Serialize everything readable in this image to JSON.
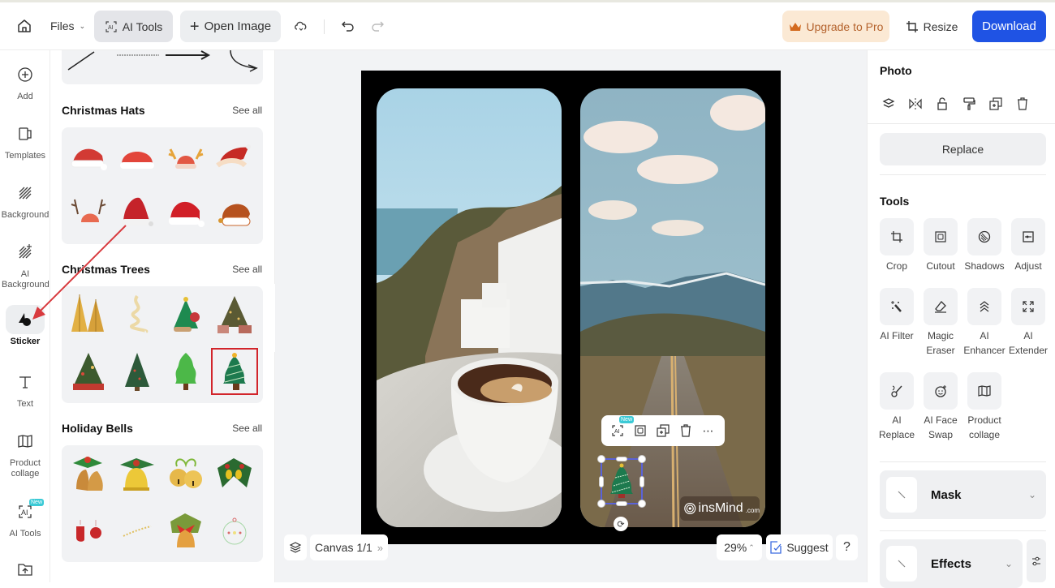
{
  "topbar": {
    "files_label": "Files",
    "ai_tools_label": "AI Tools",
    "open_image_label": "Open Image",
    "upgrade_label": "Upgrade to Pro",
    "resize_label": "Resize",
    "download_label": "Download",
    "colors": {
      "download_bg": "#1f53e4",
      "upgrade_bg": "#fbe9d4",
      "upgrade_text": "#b4622c"
    }
  },
  "leftnav": {
    "items": [
      {
        "label": "Add",
        "icon": "plus-circle-icon"
      },
      {
        "label": "Templates",
        "icon": "templates-icon"
      },
      {
        "label": "Background",
        "icon": "background-icon"
      },
      {
        "label": "AI Background",
        "icon": "ai-background-icon"
      },
      {
        "label": "Sticker",
        "icon": "sticker-icon",
        "active": true
      },
      {
        "label": "Text",
        "icon": "text-icon"
      },
      {
        "label": "Product collage",
        "icon": "collage-icon"
      },
      {
        "label": "AI Tools",
        "icon": "ai-tools-icon",
        "badge": "New"
      },
      {
        "label": "",
        "icon": "upload-icon"
      }
    ]
  },
  "sticker_panel": {
    "see_all": "See all",
    "sections": [
      {
        "title": "Christmas Hats",
        "stickers": [
          "santa-hat-1",
          "santa-hat-2",
          "reindeer-hat",
          "santa-hat-3",
          "reindeer-antlers",
          "santa-hat-4",
          "santa-hat-5",
          "brown-hat"
        ]
      },
      {
        "title": "Christmas Trees",
        "stickers": [
          "golden-trees",
          "spiral-tree",
          "cartoon-tree",
          "decorated-tree-gifts",
          "tree-with-gifts",
          "decorated-tree",
          "green-tree",
          "green-tree-lights"
        ],
        "selected_index": 7
      },
      {
        "title": "Holiday Bells",
        "stickers": [
          "golden-bells-holly",
          "yellow-bell",
          "jingle-bells",
          "holly-bells",
          "mittens",
          "sparkle-garland",
          "bells-bow",
          "ornament-ball"
        ]
      }
    ]
  },
  "canvas": {
    "page_label": "Canvas 1/1",
    "zoom": "29%",
    "suggest_label": "Suggest",
    "help_label": "?",
    "watermark": "insMind",
    "watermark_suffix": ".com",
    "float_toolbar_badge": "New"
  },
  "right_panel": {
    "photo_title": "Photo",
    "photo_actions": [
      "layers-icon",
      "flip-icon",
      "lock-icon",
      "paint-roller-icon",
      "duplicate-icon",
      "trash-icon"
    ],
    "replace_label": "Replace",
    "tools_title": "Tools",
    "tools": [
      {
        "label": "Crop",
        "icon": "crop-icon"
      },
      {
        "label": "Cutout",
        "icon": "cutout-icon"
      },
      {
        "label": "Shadows",
        "icon": "shadows-icon"
      },
      {
        "label": "Adjust",
        "icon": "adjust-icon"
      },
      {
        "label": "AI Filter",
        "icon": "ai-filter-icon"
      },
      {
        "label": "Magic Eraser",
        "icon": "eraser-icon"
      },
      {
        "label": "AI Enhancer",
        "icon": "enhancer-icon"
      },
      {
        "label": "AI Extender",
        "icon": "extender-icon"
      },
      {
        "label": "AI Replace",
        "icon": "ai-replace-icon"
      },
      {
        "label": "AI Face Swap",
        "icon": "face-swap-icon"
      },
      {
        "label": "Product collage",
        "icon": "collage-icon"
      }
    ],
    "mask_label": "Mask",
    "effects_label": "Effects"
  }
}
